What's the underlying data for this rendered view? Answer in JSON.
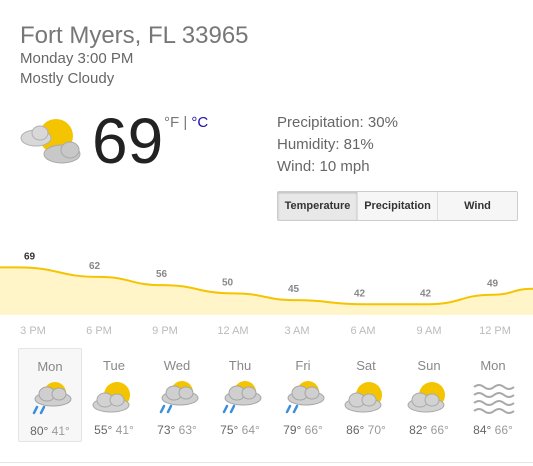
{
  "location": "Fort Myers, FL 33965",
  "time": "Monday 3:00 PM",
  "condition": "Mostly Cloudy",
  "current": {
    "temp": "69",
    "unit_f": "°F",
    "unit_sep": " | ",
    "unit_c": "°C",
    "icon": "partly-cloudy-icon"
  },
  "details": {
    "precipitation": "Precipitation: 30%",
    "humidity": "Humidity: 81%",
    "wind": "Wind: 10 mph"
  },
  "tabs": [
    "Temperature",
    "Precipitation",
    "Wind"
  ],
  "chart_data": {
    "type": "area",
    "x": [
      "3 PM",
      "6 PM",
      "9 PM",
      "12 AM",
      "3 AM",
      "6 AM",
      "9 AM",
      "12 PM"
    ],
    "values": [
      69,
      62,
      56,
      50,
      45,
      42,
      42,
      49
    ],
    "value_labels": [
      "69",
      "62",
      "56",
      "50",
      "45",
      "42",
      "42",
      "49"
    ],
    "colors": {
      "line": "#f5c400",
      "fill": "#fff5c8"
    }
  },
  "forecast": [
    {
      "day": "Mon",
      "high": "80°",
      "low": "41°",
      "icon": "rain-cloud-icon",
      "selected": true
    },
    {
      "day": "Tue",
      "high": "55°",
      "low": "41°",
      "icon": "partly-cloudy-icon"
    },
    {
      "day": "Wed",
      "high": "73°",
      "low": "63°",
      "icon": "rain-cloud-icon"
    },
    {
      "day": "Thu",
      "high": "75°",
      "low": "64°",
      "icon": "rain-cloud-icon"
    },
    {
      "day": "Fri",
      "high": "79°",
      "low": "66°",
      "icon": "rain-cloud-icon"
    },
    {
      "day": "Sat",
      "high": "86°",
      "low": "70°",
      "icon": "partly-cloudy-icon"
    },
    {
      "day": "Sun",
      "high": "82°",
      "low": "66°",
      "icon": "partly-cloudy-icon"
    },
    {
      "day": "Mon",
      "high": "84°",
      "low": "66°",
      "icon": "haze-icon"
    }
  ]
}
